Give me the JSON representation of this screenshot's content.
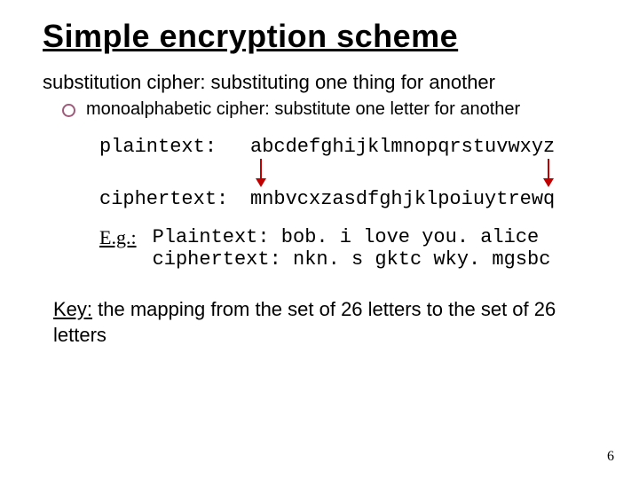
{
  "title": "Simple encryption scheme",
  "def": {
    "term": "substitution cipher:",
    "desc": " substituting one thing for another"
  },
  "sub": {
    "term": "monoalphabetic cipher:",
    "desc": " substitute one letter for another"
  },
  "cipher": {
    "plain_label": "plaintext:",
    "plain_value": "abcdefghijklmnopqrstuvwxyz",
    "cipher_label": "ciphertext:",
    "cipher_value": "mnbvcxzasdfghjklpoiuytrewq"
  },
  "example": {
    "eg_label": "E.g.:",
    "plain": "Plaintext: bob. i love you. alice",
    "cipher": "ciphertext: nkn. s gktc wky. mgsbc"
  },
  "key": {
    "label": "Key:",
    "text": " the mapping from the set of 26 letters to the set of 26 letters"
  },
  "page": "6"
}
